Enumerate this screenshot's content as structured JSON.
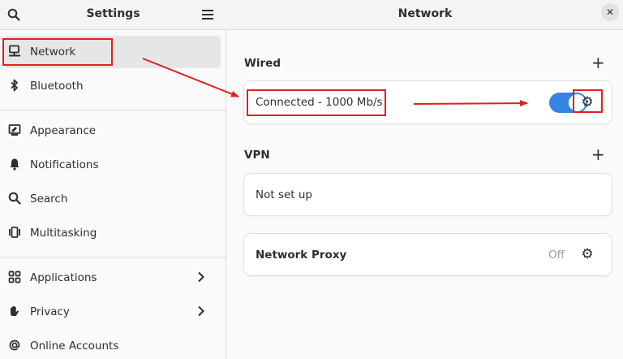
{
  "sidebar": {
    "title": "Settings",
    "items": [
      {
        "label": "Network",
        "icon": "network-wired-icon",
        "active": true
      },
      {
        "label": "Bluetooth",
        "icon": "bluetooth-icon"
      },
      {
        "label": "Appearance",
        "icon": "appearance-icon"
      },
      {
        "label": "Notifications",
        "icon": "bell-icon"
      },
      {
        "label": "Search",
        "icon": "search-icon"
      },
      {
        "label": "Multitasking",
        "icon": "multitasking-icon"
      },
      {
        "label": "Applications",
        "icon": "apps-grid-icon",
        "has_submenu": true
      },
      {
        "label": "Privacy",
        "icon": "hand-icon",
        "has_submenu": true
      },
      {
        "label": "Online Accounts",
        "icon": "at-sign-icon"
      }
    ]
  },
  "main": {
    "title": "Network",
    "wired": {
      "title": "Wired",
      "status": "Connected - 1000 Mb/s",
      "enabled": true
    },
    "vpn": {
      "title": "VPN",
      "status": "Not set up"
    },
    "proxy": {
      "label": "Network Proxy",
      "status": "Off"
    }
  },
  "colors": {
    "accent": "#3584e4",
    "annotation": "#e0201b"
  }
}
